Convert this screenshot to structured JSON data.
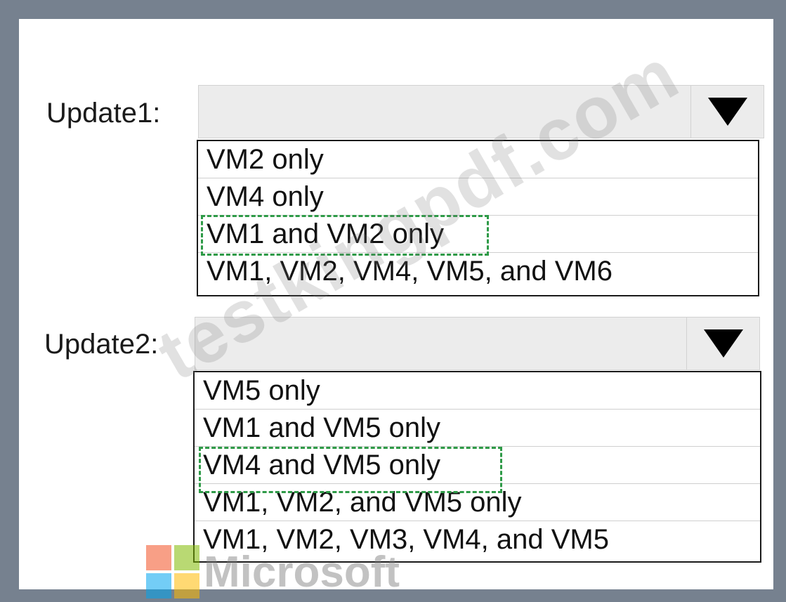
{
  "update1": {
    "label": "Update1:",
    "options": [
      "VM2 only",
      "VM4 only",
      "VM1 and VM2 only",
      "VM1, VM2, VM4, VM5, and VM6"
    ]
  },
  "update2": {
    "label": "Update2:",
    "options": [
      "VM5 only",
      "VM1 and VM5 only",
      "VM4 and VM5 only",
      "VM1, VM2, and VM5 only",
      "VM1, VM2, VM3, VM4, and VM5"
    ]
  },
  "watermark": "testkingpdf.com",
  "logo": {
    "text": "Microsoft",
    "colors": [
      "#f25022",
      "#7fba00",
      "#00a4ef",
      "#ffb900"
    ]
  }
}
